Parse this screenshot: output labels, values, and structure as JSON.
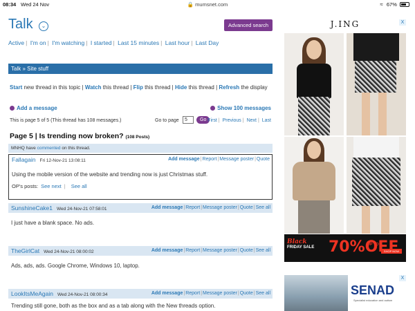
{
  "status": {
    "time": "08:34",
    "date": "Wed 24 Nov",
    "url": "mumsnet.com",
    "battery": "67%",
    "battery_level": 0.67
  },
  "header": {
    "title": "Talk",
    "advanced_search": "Advanced search"
  },
  "nav": [
    "Active",
    "I'm on",
    "I'm watching",
    "I started",
    "Last 15 minutes",
    "Last hour",
    "Last Day"
  ],
  "breadcrumb": "Talk » Site stuff",
  "thread_actions": {
    "start": "Start",
    "start_rest": " new thread in this topic | ",
    "watch": "Watch",
    "watch_rest": " this thread | ",
    "flip": "Flip",
    "flip_rest": " this thread | ",
    "hide": "Hide",
    "hide_rest": " this thread | ",
    "refresh": "Refresh",
    "refresh_rest": " the display"
  },
  "add_message": "Add a message",
  "show_100": "Show 100 messages",
  "paging": {
    "info": "This is page 5 of 5 (This thread has 108 messages.)",
    "goto_label": "Go to page",
    "page_value": "5",
    "go": "Go",
    "first": "First",
    "previous": "Previous",
    "next": "Next",
    "last": "Last"
  },
  "page_heading": {
    "title": "Page 5 | Is trending now broken?",
    "posts": "(108 Posts)"
  },
  "mnhq": {
    "prefix": "MNHQ have ",
    "link": "commented",
    "suffix": " on this thread."
  },
  "post_actions": {
    "add": "Add message",
    "report": "Report",
    "poster": "Message poster",
    "quote": "Quote",
    "see_all": "See all"
  },
  "op_posts": {
    "label": "OP's posts:",
    "see_next": "See next",
    "see_all": "See all"
  },
  "posts": [
    {
      "poster": "Fallagain",
      "time": "Fri 12-Nov-21 13:08:11",
      "body": "Using the mobile version of the website and trending now is just Christmas stuff."
    },
    {
      "poster": "SunshineCake1",
      "time": "Wed 24-Nov-21 07:58:01",
      "body": "I just have a blank space. No ads."
    },
    {
      "poster": "TheGirlCat",
      "time": "Wed 24-Nov-21 08:00:02",
      "body": "Ads, ads, ads. Google Chrome, Windows 10, laptop."
    },
    {
      "poster": "LookItsMeAgain",
      "time": "Wed 24-Nov-21 08:00:34",
      "body": "Trending still gone, both as the box and as a tab along with the New threads option."
    }
  ],
  "ads": {
    "top_brand": "J.ING",
    "banner_black": "Black",
    "banner_friday": "FRIDAY SALE",
    "banner_pct": "70%OFF",
    "banner_upto": "UP TO",
    "banner_shop": "SHOP NOW",
    "bottom_brand": "SENAD",
    "bottom_sub": "Specialist education and autism",
    "close": "X"
  },
  "colors": {
    "link": "#2a78b5",
    "accent_purple": "#7b3a8f",
    "breadcrumb_bg": "#2a6fa8",
    "post_header_bg": "#d9e6f2"
  }
}
